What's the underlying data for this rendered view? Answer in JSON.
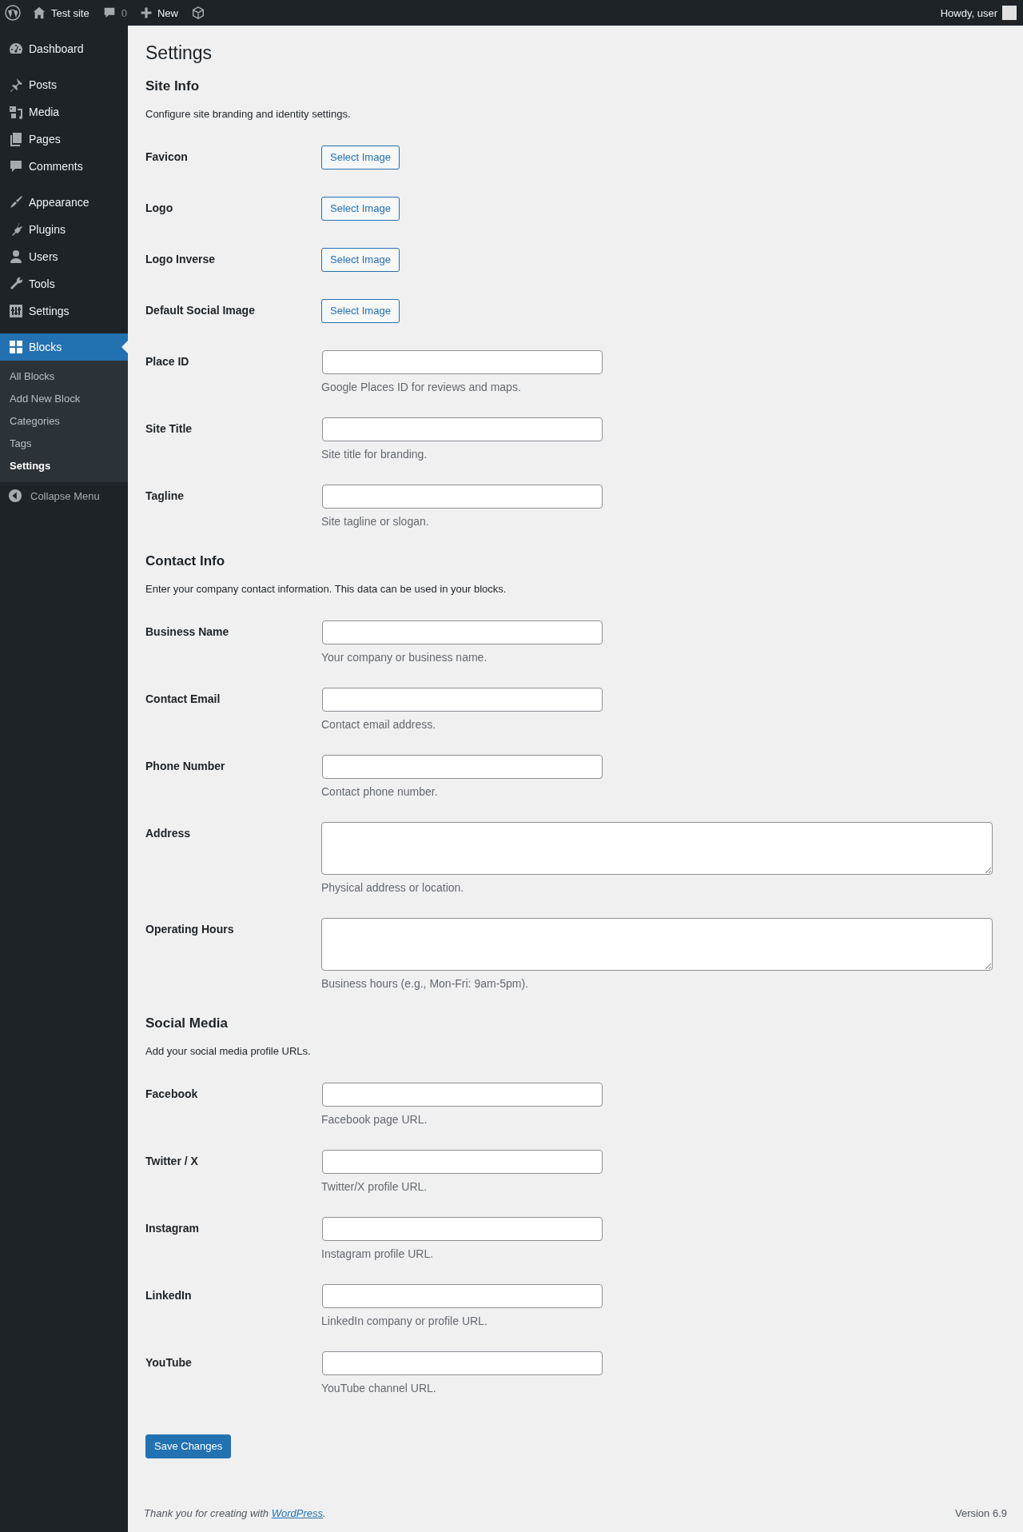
{
  "admin_bar": {
    "site_name": "Test site",
    "comments_count": "0",
    "new_label": "New",
    "greeting": "Howdy, user"
  },
  "sidebar": {
    "groups": [
      {
        "items": [
          {
            "label": "Dashboard",
            "selected": false
          }
        ]
      },
      {
        "items": [
          {
            "label": "Posts",
            "selected": false
          },
          {
            "label": "Media",
            "selected": false
          },
          {
            "label": "Pages",
            "selected": false
          },
          {
            "label": "Comments",
            "selected": false
          }
        ]
      },
      {
        "items": [
          {
            "label": "Appearance",
            "selected": false
          },
          {
            "label": "Plugins",
            "selected": false
          },
          {
            "label": "Users",
            "selected": false
          },
          {
            "label": "Tools",
            "selected": false
          },
          {
            "label": "Settings",
            "selected": false
          }
        ]
      },
      {
        "items": [
          {
            "label": "Blocks",
            "selected": true,
            "children": [
              {
                "label": "All Blocks",
                "selected": false
              },
              {
                "label": "Add New Block",
                "selected": false
              },
              {
                "label": "Categories",
                "selected": false
              },
              {
                "label": "Tags",
                "selected": false
              },
              {
                "label": "Settings",
                "selected": true
              }
            ]
          }
        ]
      }
    ],
    "collapse_label": "Collapse Menu"
  },
  "page": {
    "title": "Settings",
    "sections": [
      {
        "heading": "Site Info",
        "description": "Configure site branding and identity settings.",
        "fields": [
          {
            "kind": "image",
            "label": "Favicon",
            "button": "Select Image"
          },
          {
            "kind": "image",
            "label": "Logo",
            "button": "Select Image"
          },
          {
            "kind": "image",
            "label": "Logo Inverse",
            "button": "Select Image"
          },
          {
            "kind": "image",
            "label": "Default Social Image",
            "button": "Select Image"
          },
          {
            "kind": "text",
            "label": "Place ID",
            "help": "Google Places ID for reviews and maps."
          },
          {
            "kind": "text",
            "label": "Site Title",
            "help": "Site title for branding."
          },
          {
            "kind": "text",
            "label": "Tagline",
            "help": "Site tagline or slogan."
          }
        ]
      },
      {
        "heading": "Contact Info",
        "description": "Enter your company contact information. This data can be used in your blocks.",
        "fields": [
          {
            "kind": "text",
            "label": "Business Name",
            "help": "Your company or business name."
          },
          {
            "kind": "text",
            "label": "Contact Email",
            "help": "Contact email address."
          },
          {
            "kind": "text",
            "label": "Phone Number",
            "help": "Contact phone number."
          },
          {
            "kind": "textarea",
            "label": "Address",
            "help": "Physical address or location."
          },
          {
            "kind": "textarea",
            "label": "Operating Hours",
            "help": "Business hours (e.g., Mon-Fri: 9am-5pm)."
          }
        ]
      },
      {
        "heading": "Social Media",
        "description": "Add your social media profile URLs.",
        "fields": [
          {
            "kind": "text",
            "label": "Facebook",
            "help": "Facebook page URL."
          },
          {
            "kind": "text",
            "label": "Twitter / X",
            "help": "Twitter/X profile URL."
          },
          {
            "kind": "text",
            "label": "Instagram",
            "help": "Instagram profile URL."
          },
          {
            "kind": "text",
            "label": "LinkedIn",
            "help": "LinkedIn company or profile URL."
          },
          {
            "kind": "text",
            "label": "YouTube",
            "help": "YouTube channel URL."
          }
        ]
      }
    ],
    "save_button": "Save Changes"
  },
  "footer": {
    "thanks": "Thank you for creating with ",
    "link": "WordPress",
    "after": ".",
    "version": "Version 6.9"
  }
}
